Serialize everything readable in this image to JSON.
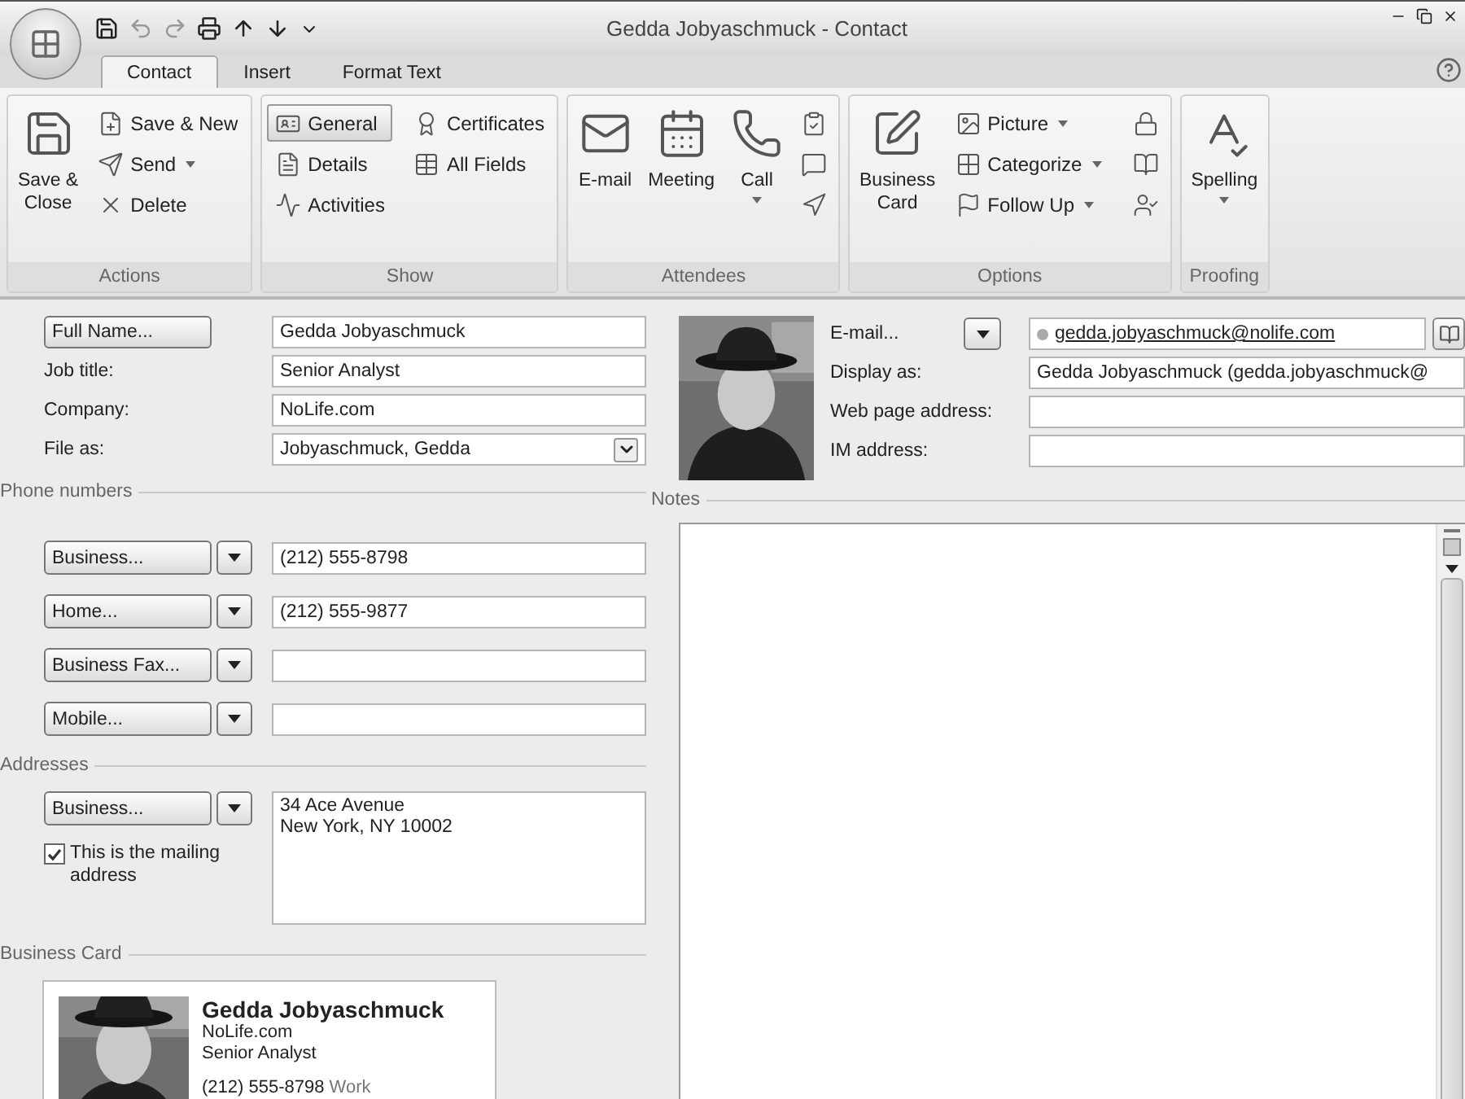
{
  "window": {
    "title": "Gedda Jobyaschmuck - Contact"
  },
  "tabs": [
    {
      "label": "Contact",
      "selected": true
    },
    {
      "label": "Insert",
      "selected": false
    },
    {
      "label": "Format Text",
      "selected": false
    }
  ],
  "ribbon": {
    "groups": [
      {
        "label": "Actions",
        "buttons": [
          {
            "kind": "large",
            "label": "Save &\nClose"
          },
          {
            "kind": "small",
            "label": "Save & New"
          },
          {
            "kind": "small",
            "label": "Send",
            "dropdown": true
          },
          {
            "kind": "small",
            "label": "Delete"
          }
        ]
      },
      {
        "label": "Show",
        "buttons": [
          {
            "kind": "small",
            "label": "General",
            "selected": true
          },
          {
            "kind": "small",
            "label": "Details",
            "selected": false
          },
          {
            "kind": "small",
            "label": "Activities",
            "selected": false
          },
          {
            "kind": "small",
            "label": "Certificates",
            "selected": false
          },
          {
            "kind": "small",
            "label": "All Fields",
            "selected": false
          }
        ]
      },
      {
        "label": "Attendees",
        "buttons": [
          {
            "kind": "large",
            "label": "E-mail"
          },
          {
            "kind": "large",
            "label": "Meeting"
          },
          {
            "kind": "large",
            "label": "Call",
            "dropdown": true
          },
          {
            "kind": "icon"
          },
          {
            "kind": "icon"
          },
          {
            "kind": "icon"
          }
        ]
      },
      {
        "label": "Options",
        "buttons": [
          {
            "kind": "large",
            "label": "Business\nCard"
          },
          {
            "kind": "small",
            "label": "Picture",
            "dropdown": true
          },
          {
            "kind": "small",
            "label": "Categorize",
            "dropdown": true
          },
          {
            "kind": "small",
            "label": "Follow Up",
            "dropdown": true
          },
          {
            "kind": "icon"
          },
          {
            "kind": "icon"
          },
          {
            "kind": "icon"
          }
        ]
      },
      {
        "label": "Proofing",
        "buttons": [
          {
            "kind": "large",
            "label": "Spelling",
            "dropdown": true
          }
        ]
      }
    ]
  },
  "general_fields": [
    {
      "kind": "button",
      "label": "Full Name...",
      "value": "Gedda Jobyaschmuck"
    },
    {
      "kind": "text",
      "label": "Job title:",
      "value": "Senior Analyst"
    },
    {
      "kind": "text",
      "label": "Company:",
      "value": "NoLife.com"
    },
    {
      "kind": "combo",
      "label": "File as:",
      "value": "Jobyaschmuck, Gedda"
    }
  ],
  "phone_numbers": {
    "title": "Phone numbers",
    "rows": [
      {
        "label": "Business...",
        "value": "(212) 555-8798"
      },
      {
        "label": "Home...",
        "value": "(212) 555-9877"
      },
      {
        "label": "Business Fax..."
      },
      {
        "label": "Mobile..."
      }
    ]
  },
  "addresses": {
    "title": "Addresses",
    "type": "Business...",
    "value": "34 Ace Avenue\nNew York, NY 10002",
    "mailing": {
      "label": "This is the mailing address",
      "checked": true
    }
  },
  "business_card": {
    "title": "Business Card",
    "name": "Gedda Jobyaschmuck",
    "lines": [
      "NoLife.com",
      "Senior Analyst"
    ],
    "phone": "(212) 555-8798",
    "phone_label": "Work"
  },
  "email": {
    "label": "E-mail...",
    "value": "gedda.jobyaschmuck@nolife.com"
  },
  "internet_fields": [
    {
      "label": "Display as:",
      "value": "Gedda Jobyaschmuck (gedda.jobyaschmuck@"
    },
    {
      "label": "Web page address:"
    },
    {
      "label": "IM address:"
    }
  ],
  "notes": {
    "title": "Notes"
  }
}
